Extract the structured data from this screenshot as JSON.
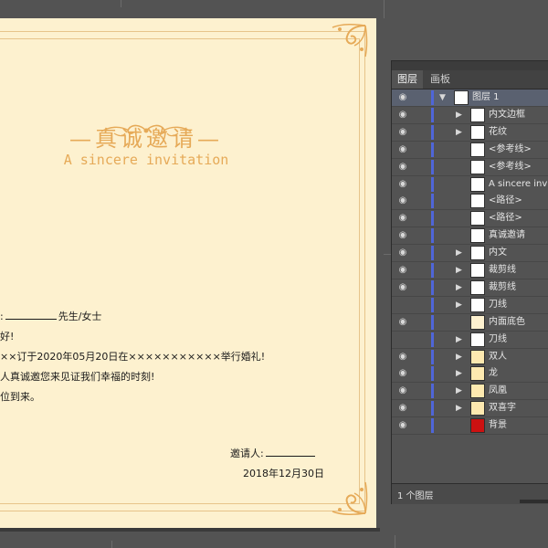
{
  "document": {
    "title_cn": "—真诚邀请—",
    "title_en": "A sincere invitation",
    "salutation_suffix": "先生/女士",
    "greeting": "好!",
    "line1": "××订于2020年05月20日在×××××××××××举行婚礼!",
    "line2": "人真诚邀您来见证我们幸福的时刻!",
    "line3": "位到来。",
    "inviter_label": "邀请人:",
    "date": "2018年12月30日",
    "salutation_prefix": ":"
  },
  "layers_panel": {
    "tabs": [
      "图层",
      "画板"
    ],
    "active_tab": "图层",
    "layers": [
      {
        "name": "图层 1",
        "level": 0,
        "expanded": true,
        "selected": true,
        "visible": true,
        "thumb_color": "#ffffff"
      },
      {
        "name": "内文边框",
        "level": 1,
        "expandable": true,
        "visible": true,
        "thumb_color": "#ffffff"
      },
      {
        "name": "花纹",
        "level": 1,
        "expandable": true,
        "visible": true,
        "thumb_color": "#ffffff"
      },
      {
        "name": "<参考线>",
        "level": 1,
        "expandable": false,
        "visible": true,
        "thumb_color": "#ffffff"
      },
      {
        "name": "<参考线>",
        "level": 1,
        "expandable": false,
        "visible": true,
        "thumb_color": "#ffffff"
      },
      {
        "name": "A sincere inv",
        "level": 1,
        "expandable": false,
        "visible": true,
        "thumb_color": "#ffffff"
      },
      {
        "name": "<路径>",
        "level": 1,
        "expandable": false,
        "visible": true,
        "thumb_color": "#ffffff"
      },
      {
        "name": "<路径>",
        "level": 1,
        "expandable": false,
        "visible": true,
        "thumb_color": "#ffffff"
      },
      {
        "name": "真诚邀请",
        "level": 1,
        "expandable": false,
        "visible": true,
        "thumb_color": "#ffffff"
      },
      {
        "name": "内文",
        "level": 1,
        "expandable": true,
        "visible": true,
        "thumb_color": "#ffffff"
      },
      {
        "name": "裁剪线",
        "level": 1,
        "expandable": true,
        "visible": true,
        "thumb_color": "#ffffff"
      },
      {
        "name": "裁剪线",
        "level": 1,
        "expandable": true,
        "visible": true,
        "thumb_color": "#ffffff"
      },
      {
        "name": "刀线",
        "level": 1,
        "expandable": true,
        "visible": false,
        "thumb_color": "#ffffff"
      },
      {
        "name": "内面底色",
        "level": 1,
        "expandable": false,
        "visible": true,
        "thumb_color": "#fdf1cf"
      },
      {
        "name": "刀线",
        "level": 1,
        "expandable": true,
        "visible": false,
        "thumb_color": "#ffffff"
      },
      {
        "name": "双人",
        "level": 1,
        "expandable": true,
        "visible": true,
        "thumb_color": "#fde9b0"
      },
      {
        "name": "龙",
        "level": 1,
        "expandable": true,
        "visible": true,
        "thumb_color": "#fde9b0"
      },
      {
        "name": "凤凰",
        "level": 1,
        "expandable": true,
        "visible": true,
        "thumb_color": "#fde9b0"
      },
      {
        "name": "双喜字",
        "level": 1,
        "expandable": true,
        "visible": true,
        "thumb_color": "#fde9b0"
      },
      {
        "name": "背景",
        "level": 1,
        "expandable": false,
        "visible": true,
        "thumb_color": "#cc1111"
      }
    ],
    "footer": "1 个图层"
  },
  "colors": {
    "canvas_bg": "#535353",
    "paper": "#fdf1cf",
    "gold": "#e6aa58",
    "selection": "#5a6170",
    "layer_color_bar": "#4f66d8"
  }
}
